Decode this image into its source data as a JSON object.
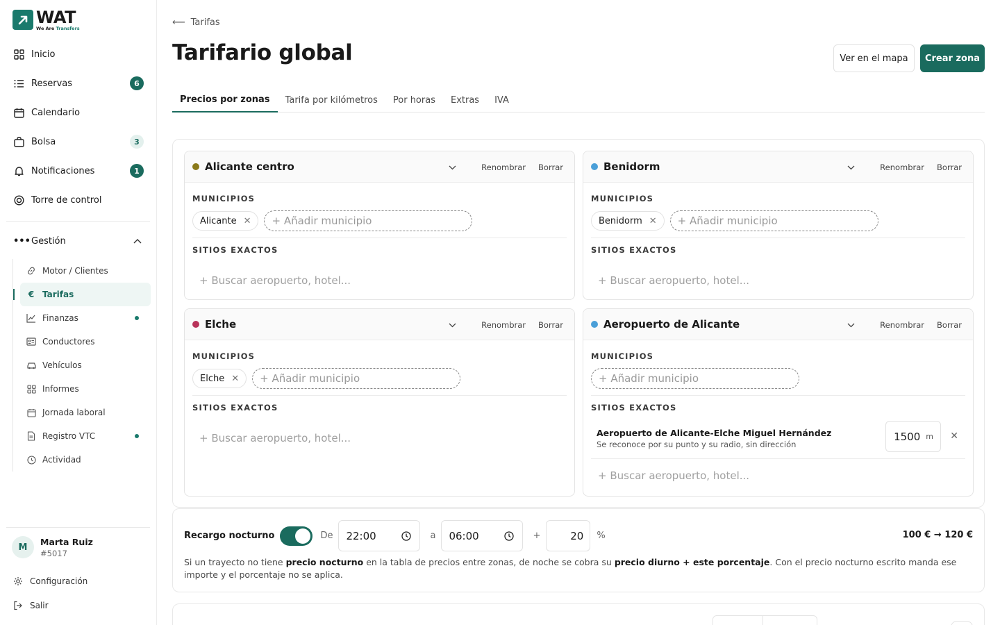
{
  "brand": {
    "name": "WAT",
    "tagline_a": "We Are ",
    "tagline_b": "Transfers",
    "accent": "#1a6b5e"
  },
  "nav": [
    {
      "key": "inicio",
      "label": "Inicio",
      "icon": "grid-icon"
    },
    {
      "key": "reservas",
      "label": "Reservas",
      "icon": "list-icon",
      "badge": "6"
    },
    {
      "key": "calendario",
      "label": "Calendario",
      "icon": "calendar-icon"
    },
    {
      "key": "bolsa",
      "label": "Bolsa",
      "icon": "bag-icon",
      "badge": "3"
    },
    {
      "key": "notificaciones",
      "label": "Notificaciones",
      "icon": "bell-icon",
      "badge": "1"
    },
    {
      "key": "torre",
      "label": "Torre de control",
      "icon": "target-icon"
    }
  ],
  "gestion": {
    "label": "Gestión",
    "items": [
      {
        "key": "motor",
        "label": "Motor / Clientes"
      },
      {
        "key": "tarifas",
        "label": "Tarifas",
        "active": true
      },
      {
        "key": "finanzas",
        "label": "Finanzas",
        "dot": true
      },
      {
        "key": "conductores",
        "label": "Conductores"
      },
      {
        "key": "vehiculos",
        "label": "Vehículos"
      },
      {
        "key": "informes",
        "label": "Informes"
      },
      {
        "key": "jornada",
        "label": "Jornada laboral"
      },
      {
        "key": "registro",
        "label": "Registro VTC",
        "dot": true
      },
      {
        "key": "actividad",
        "label": "Actividad"
      }
    ]
  },
  "user": {
    "initial": "M",
    "name": "Marta Ruiz",
    "id": "#5017"
  },
  "footer": {
    "config": "Configuración",
    "logout": "Salir"
  },
  "page": {
    "breadcrumb": "Tarifas",
    "title": "Tarifario global",
    "map_button": "Ver en el mapa",
    "create_button": "Crear zona"
  },
  "tabs": [
    "Precios por zonas",
    "Tarifa por kilómetros",
    "Por horas",
    "Extras",
    "IVA"
  ],
  "labels": {
    "municipios": "MUNICIPIOS",
    "sitios": "SITIOS EXACTOS",
    "rename": "Renombrar",
    "delete": "Borrar",
    "add_municipio": "+ Añadir municipio",
    "search_site": "+ Buscar aeropuerto, hotel..."
  },
  "zones": [
    {
      "name": "Alicante centro",
      "color": "#8a7a1a",
      "municipios": [
        "Alicante"
      ]
    },
    {
      "name": "Benidorm",
      "color": "#4a9fd8",
      "municipios": [
        "Benidorm"
      ]
    },
    {
      "name": "Elche",
      "color": "#b8335a",
      "municipios": [
        "Elche"
      ]
    },
    {
      "name": "Aeropuerto de Alicante",
      "color": "#4a9fd8",
      "municipios": [],
      "site": {
        "name": "Aeropuerto de Alicante-Elche Miguel Hernández",
        "desc": "Se reconoce por su punto y su radio, sin dirección",
        "radius": "1500",
        "unit": "m"
      }
    }
  ],
  "night": {
    "label": "Recargo nocturno",
    "from_label": "De",
    "from": "22:00",
    "to_label": "a",
    "to": "06:00",
    "plus": "+",
    "percent": "20",
    "percent_sign": "%",
    "example": "100 € → 120 €",
    "text_1": "Si un trayecto no tiene ",
    "text_b1": "precio nocturno",
    "text_2": " en la tabla de precios entre zonas, de noche se cobra su ",
    "text_b2": "precio diurno + este porcentaje",
    "text_3": ". Con el precio nocturno escrito manda ese importe y el porcentaje no se aplica."
  }
}
